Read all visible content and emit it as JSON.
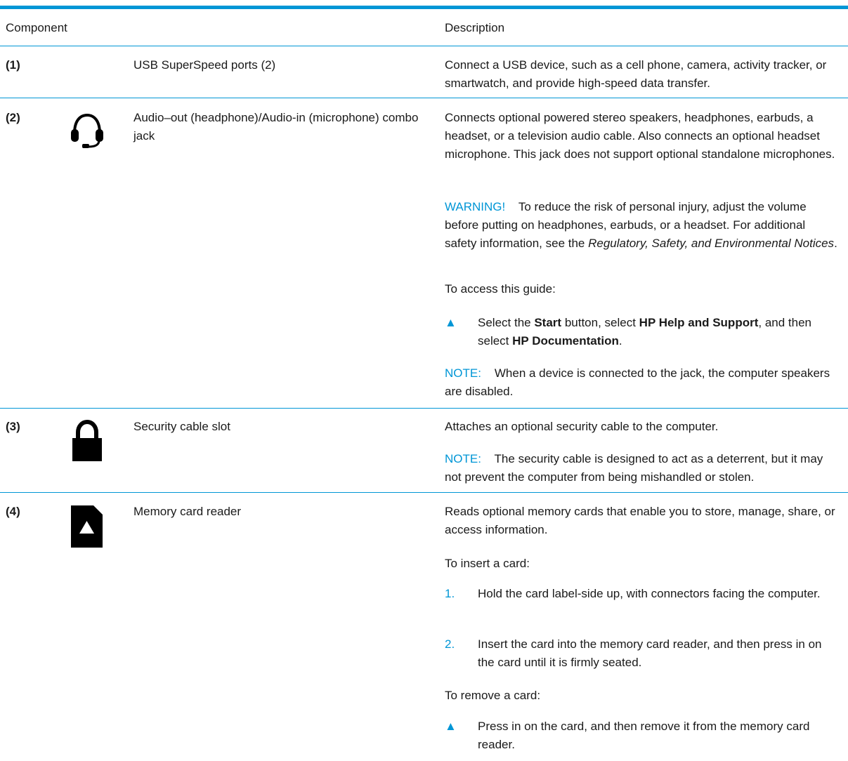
{
  "header": {
    "component": "Component",
    "description": "Description"
  },
  "rows": [
    {
      "number": "(1)",
      "icon": "",
      "name": "USB SuperSpeed ports (2)",
      "desc": "Connect a USB device, such as a cell phone, camera, activity tracker, or smartwatch, and provide high-speed data transfer."
    },
    {
      "number": "(2)",
      "icon": "headphone-icon",
      "name": "Audio–out (headphone)/Audio-in (microphone) combo jack",
      "desc": "Connects optional powered stereo speakers, headphones, earbuds, a headset, or a television audio cable. Also connects an optional headset microphone. This jack does not support optional standalone microphones.",
      "warning_label": "WARNING!",
      "warning_text": "To reduce the risk of personal injury, adjust the volume before putting on headphones, earbuds, or a headset. For additional safety information, see the",
      "warning_italic": "Regulatory, Safety, and Environmental Notices",
      "warning_end": ".",
      "access": "To access this guide:",
      "bullet_symbol": "▲",
      "bullet_pre": "Select the",
      "bullet_start": "Start",
      "bullet_mid": "button, select",
      "bullet_hp": "HP Help and Support",
      "bullet_and": ", and then select",
      "bullet_doc": "HP Documentation",
      "bullet_end": ".",
      "note_label": "NOTE:",
      "note_text": "When a device is connected to the jack, the computer speakers are disabled."
    },
    {
      "number": "(3)",
      "icon": "lock-icon",
      "name": "Security cable slot",
      "desc": "Attaches an optional security cable to the computer.",
      "note_label": "NOTE:",
      "note_text": "The security cable is designed to act as a deterrent, but it may not prevent the computer from being mishandled or stolen."
    },
    {
      "number": "(4)",
      "icon": "memory-card-icon",
      "name": "Memory card reader",
      "desc": "Reads optional memory cards that enable you to store, manage, share, or access information.",
      "insert_title": "To insert a card:",
      "step1_num": "1.",
      "step1": "Hold the card label-side up, with connectors facing the computer.",
      "step2_num": "2.",
      "step2": "Insert the card into the memory card reader, and then press in on the card until it is firmly seated.",
      "remove_title": "To remove a card:",
      "remove_symbol": "▲",
      "remove_text": "Press in on the card, and then remove it from the memory card reader."
    }
  ],
  "colors": {
    "accent": "#0096d6",
    "text": "#1a1a1a"
  }
}
